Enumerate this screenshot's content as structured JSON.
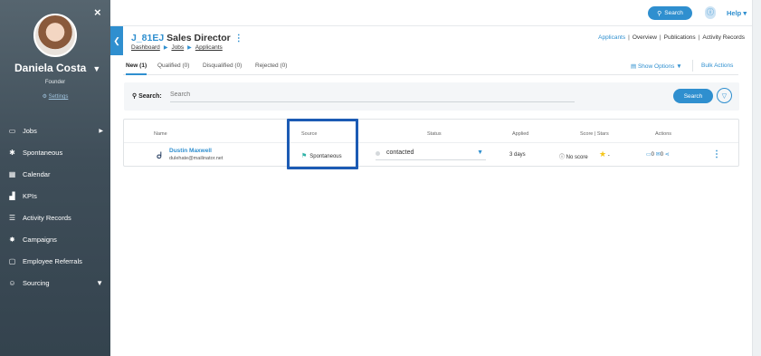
{
  "sidebar": {
    "close_icon": "×",
    "user_name": "Daniela Costa",
    "user_role": "Founder",
    "settings_label": "Settings",
    "items": [
      {
        "label": "Jobs",
        "icon": "folder-icon",
        "glyph": "▭",
        "arrow": "▶"
      },
      {
        "label": "Spontaneous",
        "icon": "asterisk-icon",
        "glyph": "✱",
        "arrow": ""
      },
      {
        "label": "Calendar",
        "icon": "calendar-icon",
        "glyph": "▦",
        "arrow": ""
      },
      {
        "label": "KPIs",
        "icon": "bar-chart-icon",
        "glyph": "▟",
        "arrow": ""
      },
      {
        "label": "Activity Records",
        "icon": "list-icon",
        "glyph": "☰",
        "arrow": ""
      },
      {
        "label": "Campaigns",
        "icon": "sparkle-icon",
        "glyph": "✸",
        "arrow": ""
      },
      {
        "label": "Employee Referrals",
        "icon": "chat-icon",
        "glyph": "▢",
        "arrow": ""
      },
      {
        "label": "Sourcing",
        "icon": "users-icon",
        "glyph": "☺",
        "arrow": "▼"
      }
    ]
  },
  "topbar": {
    "search_label": "Search",
    "help_label": "Help"
  },
  "job": {
    "code": "J_81EJ",
    "title": "Sales Director",
    "breadcrumb": [
      "Dashboard",
      "Jobs",
      "Applicants"
    ],
    "tab_links": [
      "Applicants",
      "Overview",
      "Publications",
      "Activity Records"
    ]
  },
  "subtabs": [
    {
      "label": "New (1)",
      "active": true
    },
    {
      "label": "Qualified (0)",
      "active": false
    },
    {
      "label": "Disqualified (0)",
      "active": false
    },
    {
      "label": "Rejected (0)",
      "active": false
    }
  ],
  "options": {
    "show_options_label": "Show Options",
    "bulk_actions_label": "Bulk Actions"
  },
  "filter": {
    "label": "Search:",
    "placeholder": "Search",
    "button_label": "Search"
  },
  "table": {
    "headers": [
      "Name",
      "Source",
      "Status",
      "Applied",
      "Score | Stars",
      "Actions"
    ],
    "row": {
      "name": "Dustin Maxwell",
      "email": "dulehate@mailinator.net",
      "source": "Spontaneous",
      "status": "contacted",
      "applied": "3 days",
      "score": "No score",
      "stars": "-",
      "comments_count": "0",
      "emails_count": "0"
    }
  },
  "colors": {
    "accent": "#2f8fcf",
    "sidebar": "#3f4e59",
    "highlight": "#1c5bb4"
  }
}
